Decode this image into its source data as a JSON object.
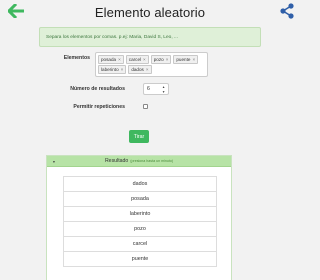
{
  "header": {
    "title": "Elemento aleatorio",
    "back_icon": "arrow-left-icon",
    "share_icon": "share-icon",
    "accent": "#3fb85f"
  },
  "hint": {
    "text": "Separa los elementos por comas. p.ej: Maria, David S, Leo, ..."
  },
  "form": {
    "elements_label": "Elementos",
    "tags": [
      {
        "label": "posada"
      },
      {
        "label": "carcel"
      },
      {
        "label": "pozo"
      },
      {
        "label": "puente"
      },
      {
        "label": "laberinto"
      },
      {
        "label": "dados"
      }
    ],
    "tag_remove": "×",
    "count_label": "Número de resultados",
    "count_value": "6",
    "repeat_label": "Permitir repeticiones",
    "repeat_checked": false
  },
  "actions": {
    "roll_label": "Tirar"
  },
  "result": {
    "title": "Resultado",
    "hint": "(presiona hasta un minuto)",
    "toggle": "▾",
    "items": [
      "dados",
      "posada",
      "laberinto",
      "pozo",
      "carcel",
      "puente"
    ]
  }
}
